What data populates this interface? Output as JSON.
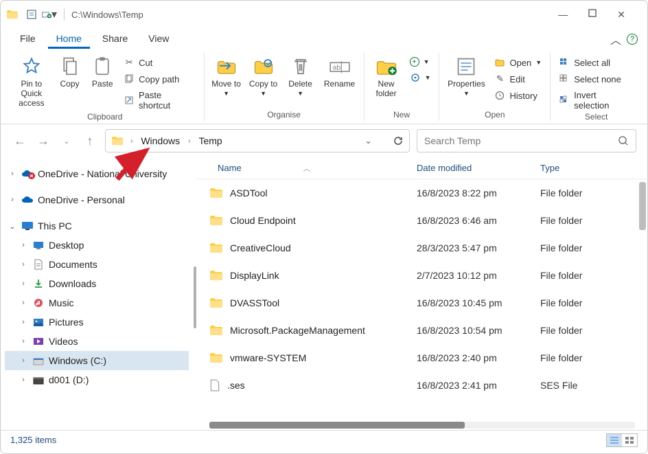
{
  "window_path_title": "C:\\Windows\\Temp",
  "menu": {
    "file": "File",
    "home": "Home",
    "share": "Share",
    "view": "View"
  },
  "ribbon": {
    "pin": "Pin to Quick access",
    "copy": "Copy",
    "paste": "Paste",
    "cut": "Cut",
    "copy_path": "Copy path",
    "paste_shortcut": "Paste shortcut",
    "clipboard": "Clipboard",
    "move_to": "Move to",
    "copy_to": "Copy to",
    "delete": "Delete",
    "rename": "Rename",
    "organise": "Organise",
    "new_folder": "New folder",
    "new": "New",
    "properties": "Properties",
    "open": "Open",
    "edit": "Edit",
    "history": "History",
    "open_group": "Open",
    "select_all": "Select all",
    "select_none": "Select none",
    "invert": "Invert selection",
    "select": "Select"
  },
  "breadcrumb": {
    "windows": "Windows",
    "temp": "Temp"
  },
  "search_placeholder": "Search Temp",
  "nav": {
    "onedrive_nat": "OneDrive - National University",
    "onedrive_personal": "OneDrive - Personal",
    "this_pc": "This PC",
    "desktop": "Desktop",
    "documents": "Documents",
    "downloads": "Downloads",
    "music": "Music",
    "pictures": "Pictures",
    "videos": "Videos",
    "windows_c": "Windows (C:)",
    "d001": "d001 (D:)"
  },
  "columns": {
    "name": "Name",
    "date": "Date modified",
    "type": "Type"
  },
  "files": [
    {
      "name": "ASDTool",
      "date": "16/8/2023 8:22 pm",
      "type": "File folder",
      "icon": "folder"
    },
    {
      "name": "Cloud Endpoint",
      "date": "16/8/2023 6:46 am",
      "type": "File folder",
      "icon": "folder"
    },
    {
      "name": "CreativeCloud",
      "date": "28/3/2023 5:47 pm",
      "type": "File folder",
      "icon": "folder"
    },
    {
      "name": "DisplayLink",
      "date": "2/7/2023 10:12 pm",
      "type": "File folder",
      "icon": "folder"
    },
    {
      "name": "DVASSTool",
      "date": "16/8/2023 10:45 pm",
      "type": "File folder",
      "icon": "folder"
    },
    {
      "name": "Microsoft.PackageManagement",
      "date": "16/8/2023 10:54 pm",
      "type": "File folder",
      "icon": "folder"
    },
    {
      "name": "vmware-SYSTEM",
      "date": "16/8/2023 2:40 pm",
      "type": "File folder",
      "icon": "folder"
    },
    {
      "name": ".ses",
      "date": "16/8/2023 2:41 pm",
      "type": "SES File",
      "icon": "file"
    }
  ],
  "status": "1,325 items"
}
